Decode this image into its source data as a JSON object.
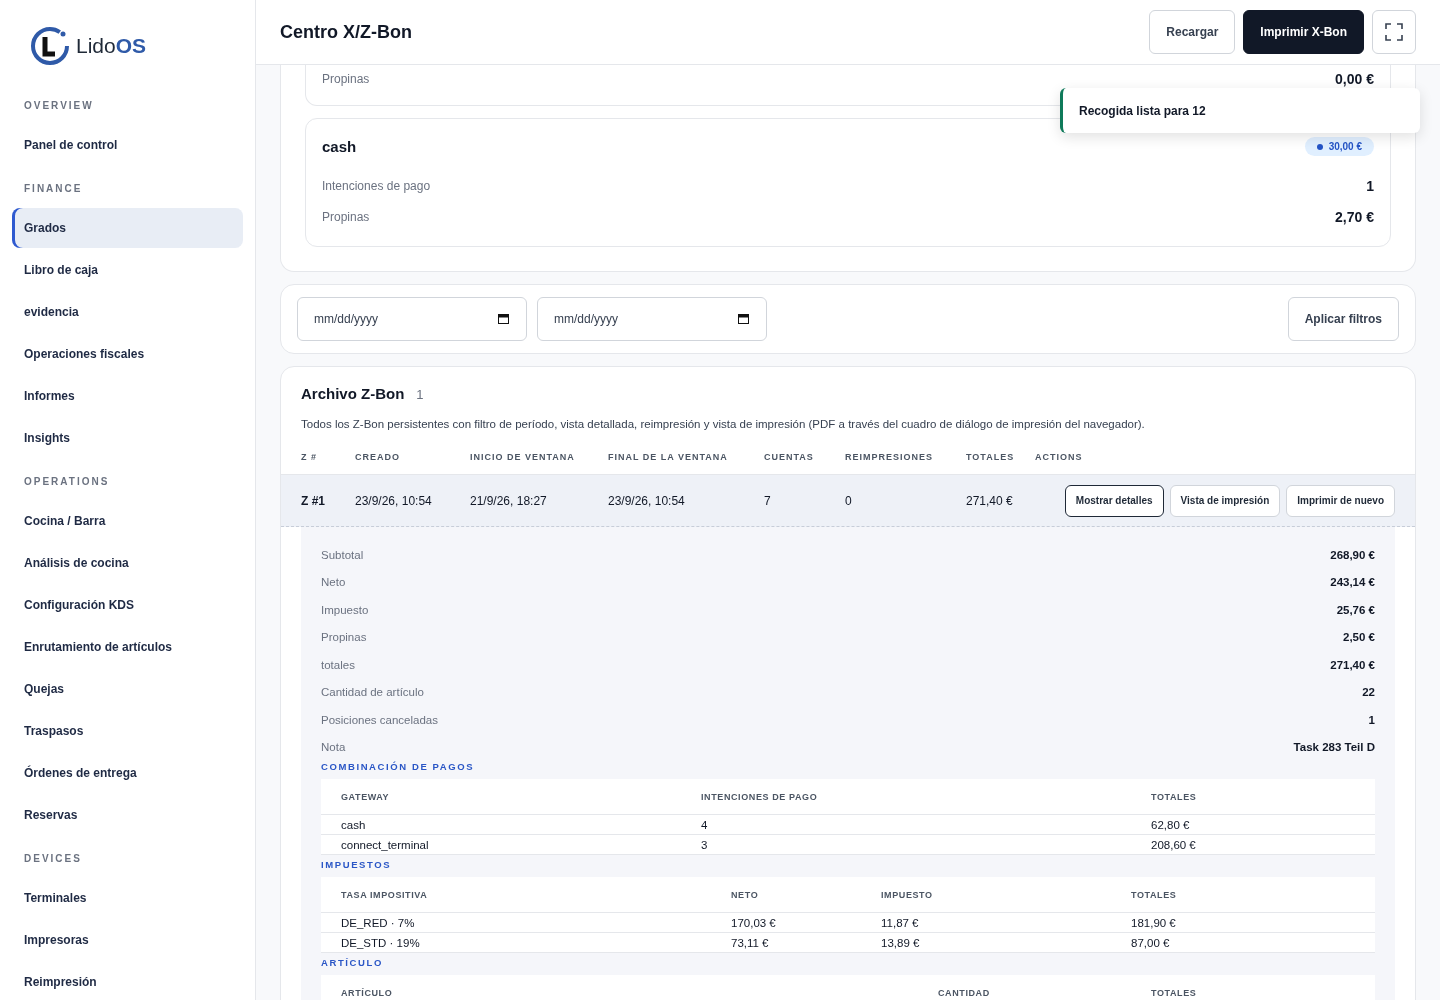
{
  "brand": {
    "name": "Lido",
    "suffix": "OS"
  },
  "sidebar": [
    {
      "heading": "OVERVIEW",
      "items": [
        {
          "label": "Panel de control",
          "selected": false
        }
      ]
    },
    {
      "heading": "FINANCE",
      "items": [
        {
          "label": "Grados",
          "selected": true
        },
        {
          "label": "Libro de caja",
          "selected": false
        },
        {
          "label": "evidencia",
          "selected": false
        },
        {
          "label": "Operaciones fiscales",
          "selected": false
        },
        {
          "label": "Informes",
          "selected": false
        },
        {
          "label": "Insights",
          "selected": false
        }
      ]
    },
    {
      "heading": "OPERATIONS",
      "items": [
        {
          "label": "Cocina / Barra",
          "selected": false
        },
        {
          "label": "Análisis de cocina",
          "selected": false
        },
        {
          "label": "Configuración KDS",
          "selected": false
        },
        {
          "label": "Enrutamiento de artículos",
          "selected": false
        },
        {
          "label": "Quejas",
          "selected": false
        },
        {
          "label": "Traspasos",
          "selected": false
        },
        {
          "label": "Órdenes de entrega",
          "selected": false
        },
        {
          "label": "Reservas",
          "selected": false
        }
      ]
    },
    {
      "heading": "DEVICES",
      "items": [
        {
          "label": "Terminales",
          "selected": false
        },
        {
          "label": "Impresoras",
          "selected": false
        },
        {
          "label": "Reimpresión",
          "selected": false
        }
      ]
    }
  ],
  "header": {
    "title": "Centro X/Z-Bon",
    "buttons": [
      {
        "label": "Recargar",
        "kind": "secondary"
      },
      {
        "label": "Imprimir X-Bon",
        "kind": "primary"
      }
    ]
  },
  "toast": {
    "text": "Recogida lista para 12"
  },
  "gateways": [
    {
      "rows": [
        {
          "label": "Propinas",
          "value": "0,00 €"
        }
      ]
    },
    {
      "name": "cash",
      "badge": "30,00 €",
      "rows": [
        {
          "label": "Intenciones de pago",
          "value": "1"
        },
        {
          "label": "Propinas",
          "value": "2,70 €"
        }
      ]
    }
  ],
  "filters": {
    "date_from": {
      "placeholder": "mm/dd/yyyy"
    },
    "date_to": {
      "placeholder": "mm/dd/yyyy"
    },
    "apply": "Aplicar filtros"
  },
  "archive": {
    "title": "Archivo Z-Bon",
    "count": "1",
    "description": "Todos los Z-Bon persistentes con filtro de período, vista detallada, reimpresión y vista de impresión (PDF a través del cuadro de diálogo de impresión del navegador).",
    "columns": [
      "Z #",
      "CREADO",
      "INICIO DE VENTANA",
      "FINAL DE LA VENTANA",
      "CUENTAS",
      "REIMPRESIONES",
      "TOTALES",
      "ACTIONS"
    ],
    "rows": [
      {
        "cells": [
          "Z #1",
          "23/9/26, 10:54",
          "21/9/26, 18:27",
          "23/9/26, 10:54",
          "7",
          "0",
          "271,40 €"
        ],
        "expanded": true,
        "actions": [
          {
            "label": "Mostrar detalles",
            "selected": true
          },
          {
            "label": "Vista de impresión",
            "selected": false
          },
          {
            "label": "Imprimir de nuevo",
            "selected": false
          }
        ],
        "details": {
          "summary": [
            {
              "label": "Subtotal",
              "value": "268,90 €"
            },
            {
              "label": "Neto",
              "value": "243,14 €"
            },
            {
              "label": "Impuesto",
              "value": "25,76 €"
            },
            {
              "label": "Propinas",
              "value": "2,50 €"
            },
            {
              "label": "totales",
              "value": "271,40 €"
            },
            {
              "label": "Cantidad de artículo",
              "value": "22"
            },
            {
              "label": "Posiciones canceladas",
              "value": "1"
            },
            {
              "label": "Nota",
              "value": "Task 283 Teil D"
            }
          ],
          "sections": [
            {
              "title": "COMBINACIÓN DE PAGOS",
              "columns": [
                "GATEWAY",
                "INTENCIONES DE PAGO",
                "TOTALES"
              ],
              "rows": [
                [
                  "cash",
                  "4",
                  "62,80 €"
                ],
                [
                  "connect_terminal",
                  "3",
                  "208,60 €"
                ]
              ]
            },
            {
              "title": "IMPUESTOS",
              "columns": [
                "TASA IMPOSITIVA",
                "NETO",
                "IMPUESTO",
                "TOTALES"
              ],
              "rows": [
                [
                  "DE_RED · 7%",
                  "170,03 €",
                  "11,87 €",
                  "181,90 €"
                ],
                [
                  "DE_STD · 19%",
                  "73,11 €",
                  "13,89 €",
                  "87,00 €"
                ]
              ]
            },
            {
              "title": "ARTÍCULO",
              "columns": [
                "ARTÍCULO",
                "CANTIDAD",
                "TOTALES"
              ]
            }
          ]
        }
      }
    ]
  }
}
